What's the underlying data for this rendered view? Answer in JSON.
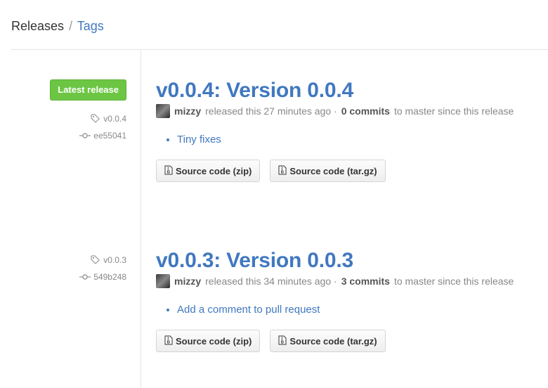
{
  "subnav": {
    "releases": "Releases",
    "separator": "/",
    "tags": "Tags"
  },
  "releases": [
    {
      "latest_label": "Latest release",
      "tag": "v0.0.4",
      "commit": "ee55041",
      "title": "v0.0.4: Version 0.0.4",
      "author": "mizzy",
      "released_text": "released this 27 minutes ago ·",
      "commits": "0 commits",
      "since_text": "to master since this release",
      "notes": [
        "Tiny fixes"
      ],
      "source_zip": "Source code (zip)",
      "source_targz": "Source code (tar.gz)"
    },
    {
      "tag": "v0.0.3",
      "commit": "549b248",
      "title": "v0.0.3: Version 0.0.3",
      "author": "mizzy",
      "released_text": "released this 34 minutes ago ·",
      "commits": "3 commits",
      "since_text": "to master since this release",
      "notes": [
        "Add a comment to pull request"
      ],
      "source_zip": "Source code (zip)",
      "source_targz": "Source code (tar.gz)"
    }
  ],
  "colors": {
    "link": "#4078c0",
    "latest_badge": "#6cc644",
    "muted": "#888888"
  }
}
